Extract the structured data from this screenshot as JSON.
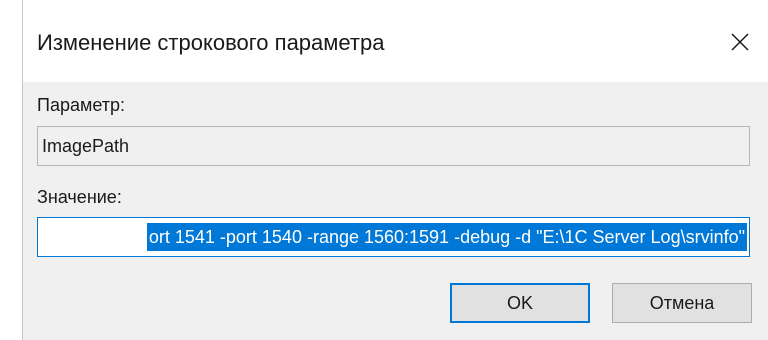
{
  "dialog": {
    "title": "Изменение строкового параметра",
    "close_icon": "close-icon"
  },
  "parameter": {
    "label": "Параметр:",
    "value": "ImagePath"
  },
  "value_field": {
    "label": "Значение:",
    "visible_value": "ort 1541 -port 1540 -range 1560:1591 -debug -d \"E:\\1C Server Log\\srvinfo\"",
    "selected": true
  },
  "buttons": {
    "ok_label": "OK",
    "cancel_label": "Отмена"
  },
  "colors": {
    "accent": "#0078d7",
    "body_background": "#f0f0f0",
    "button_face": "#e1e1e1"
  }
}
